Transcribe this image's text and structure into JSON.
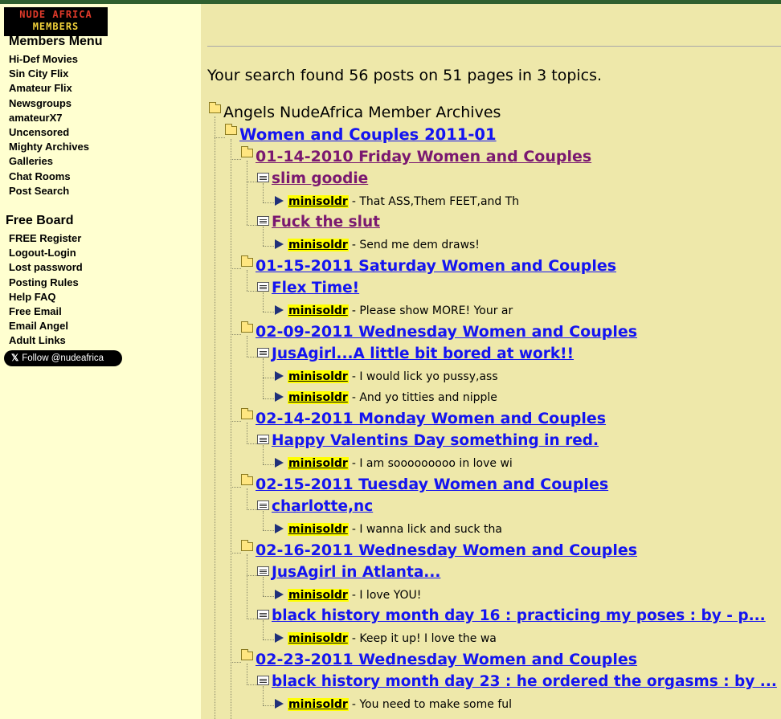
{
  "sidebar": {
    "logo_line1": "NUDE AFRICA",
    "logo_line2": "MEMBERS",
    "members_menu_title": "Members Menu",
    "members_menu": [
      "Hi-Def Movies",
      "Sin City Flix",
      "Amateur Flix",
      "Newsgroups",
      "amateurX7",
      "Uncensored",
      "Mighty Archives",
      "Galleries",
      "Chat Rooms",
      "Post Search"
    ],
    "free_board_title": "Free Board",
    "free_board": [
      "FREE Register",
      "Logout-Login",
      "Lost password",
      "Posting Rules",
      "Help FAQ",
      "Free Email",
      "Email Angel",
      "Adult Links"
    ],
    "follow_button": "Follow @nudeafrica",
    "follow_icon": "x-logo-icon"
  },
  "main": {
    "summary": "Your search found 56 posts on 51 pages in 3 topics.",
    "root_label": "Angels NudeAfrica Member Archives",
    "forum_label": "Women and Couples 2011-01",
    "topics": [
      {
        "title": "01-14-2010 Friday Women and Couples",
        "visited": true,
        "threads": [
          {
            "title": "slim goodie",
            "visited": true,
            "replies": [
              {
                "author": "minisoldr",
                "text": "That ASS,Them FEET,and Th"
              }
            ]
          },
          {
            "title": "Fuck the slut",
            "visited": true,
            "replies": [
              {
                "author": "minisoldr",
                "text": "Send me dem draws!"
              }
            ]
          }
        ]
      },
      {
        "title": "01-15-2011 Saturday Women and Couples",
        "visited": false,
        "threads": [
          {
            "title": "Flex Time!",
            "visited": false,
            "replies": [
              {
                "author": "minisoldr",
                "text": "Please show MORE! Your ar"
              }
            ]
          }
        ]
      },
      {
        "title": "02-09-2011 Wednesday Women and Couples",
        "visited": false,
        "threads": [
          {
            "title": "JusAgirl...A little bit bored at work!!",
            "visited": false,
            "replies": [
              {
                "author": "minisoldr",
                "text": "I would lick yo pussy,ass"
              },
              {
                "author": "minisoldr",
                "text": "And yo titties and nipple"
              }
            ]
          }
        ]
      },
      {
        "title": "02-14-2011 Monday Women and Couples",
        "visited": false,
        "threads": [
          {
            "title": "Happy Valentins Day something in red.",
            "visited": false,
            "replies": [
              {
                "author": "minisoldr",
                "text": "I am sooooooooo in love wi"
              }
            ]
          }
        ]
      },
      {
        "title": "02-15-2011 Tuesday Women and Couples",
        "visited": false,
        "threads": [
          {
            "title": "charlotte,nc",
            "visited": false,
            "replies": [
              {
                "author": "minisoldr",
                "text": "I wanna lick and suck tha"
              }
            ]
          }
        ]
      },
      {
        "title": "02-16-2011 Wednesday Women and Couples",
        "visited": false,
        "threads": [
          {
            "title": "JusAgirl in Atlanta...",
            "visited": false,
            "replies": [
              {
                "author": "minisoldr",
                "text": "I love YOU!"
              }
            ]
          },
          {
            "title": "black history month day 16 : practicing my poses : by - p...",
            "visited": false,
            "replies": [
              {
                "author": "minisoldr",
                "text": "Keep it up! I love the wa"
              }
            ]
          }
        ]
      },
      {
        "title": "02-23-2011 Wednesday Women and Couples",
        "visited": false,
        "threads": [
          {
            "title": "black history month day 23 : he ordered the orgasms : by ...",
            "visited": false,
            "replies": [
              {
                "author": "minisoldr",
                "text": "You need to make some ful"
              }
            ]
          }
        ]
      }
    ]
  }
}
